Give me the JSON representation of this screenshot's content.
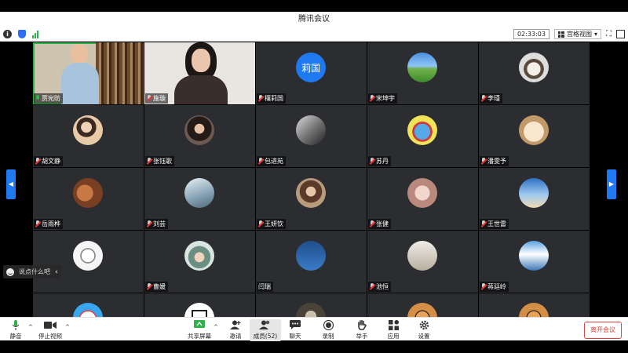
{
  "window": {
    "title": "腾讯会议"
  },
  "topbar": {
    "timer": "02:33:03",
    "view_label": "宫格视图"
  },
  "participants": [
    {
      "name": "贾宛昉",
      "mic": "on",
      "kind": "video1"
    },
    {
      "name": "施璇",
      "mic": "off",
      "kind": "video2"
    },
    {
      "name": "穰莉国",
      "mic": "off",
      "kind": "text",
      "avatar_text": "莉国"
    },
    {
      "name": "宋坤宇",
      "mic": "off",
      "kind": "landscape"
    },
    {
      "name": "李瑾",
      "mic": "off",
      "kind": "cat"
    },
    {
      "name": "胡文静",
      "mic": "off",
      "kind": "girl"
    },
    {
      "name": "张钰歌",
      "mic": "off",
      "kind": "woman"
    },
    {
      "name": "包进苑",
      "mic": "off",
      "kind": "bw"
    },
    {
      "name": "苏丹",
      "mic": "off",
      "kind": "cartoon"
    },
    {
      "name": "潘雯予",
      "mic": "off",
      "kind": "dog"
    },
    {
      "name": "岳雨桦",
      "mic": "off",
      "kind": "warm"
    },
    {
      "name": "刘芸",
      "mic": "off",
      "kind": "sea"
    },
    {
      "name": "王妍钦",
      "mic": "off",
      "kind": "portrait"
    },
    {
      "name": "张健",
      "mic": "off",
      "kind": "pink"
    },
    {
      "name": "王世雷",
      "mic": "off",
      "kind": "sky"
    },
    {
      "name": "",
      "mic": "none",
      "kind": "sketch"
    },
    {
      "name": "曹媛",
      "mic": "off",
      "kind": "hat"
    },
    {
      "name": "闫瑞",
      "mic": "none",
      "kind": "blue"
    },
    {
      "name": "池恒",
      "mic": "off",
      "kind": "tower"
    },
    {
      "name": "蒋廷岭",
      "mic": "off",
      "kind": "mountain"
    },
    {
      "name": "",
      "mic": "none",
      "kind": "robot"
    },
    {
      "name": "",
      "mic": "none",
      "kind": "frame"
    },
    {
      "name": "",
      "mic": "none",
      "kind": "oldman"
    },
    {
      "name": "",
      "mic": "none",
      "kind": "tiger"
    },
    {
      "name": "",
      "mic": "none",
      "kind": "tiger"
    }
  ],
  "chat": {
    "placeholder": "说点什么吧"
  },
  "controls": {
    "mute": "静音",
    "stop_video": "停止视频",
    "share": "共享屏幕",
    "invite": "邀请",
    "members": "成员(52)",
    "chat": "聊天",
    "record": "录制",
    "raise_hand": "举手",
    "apps": "应用",
    "settings": "设置",
    "leave": "离开会议"
  },
  "colors": {
    "accent": "#1f7af2",
    "leave": "#e5423d",
    "active_speaker": "#2db34a"
  }
}
